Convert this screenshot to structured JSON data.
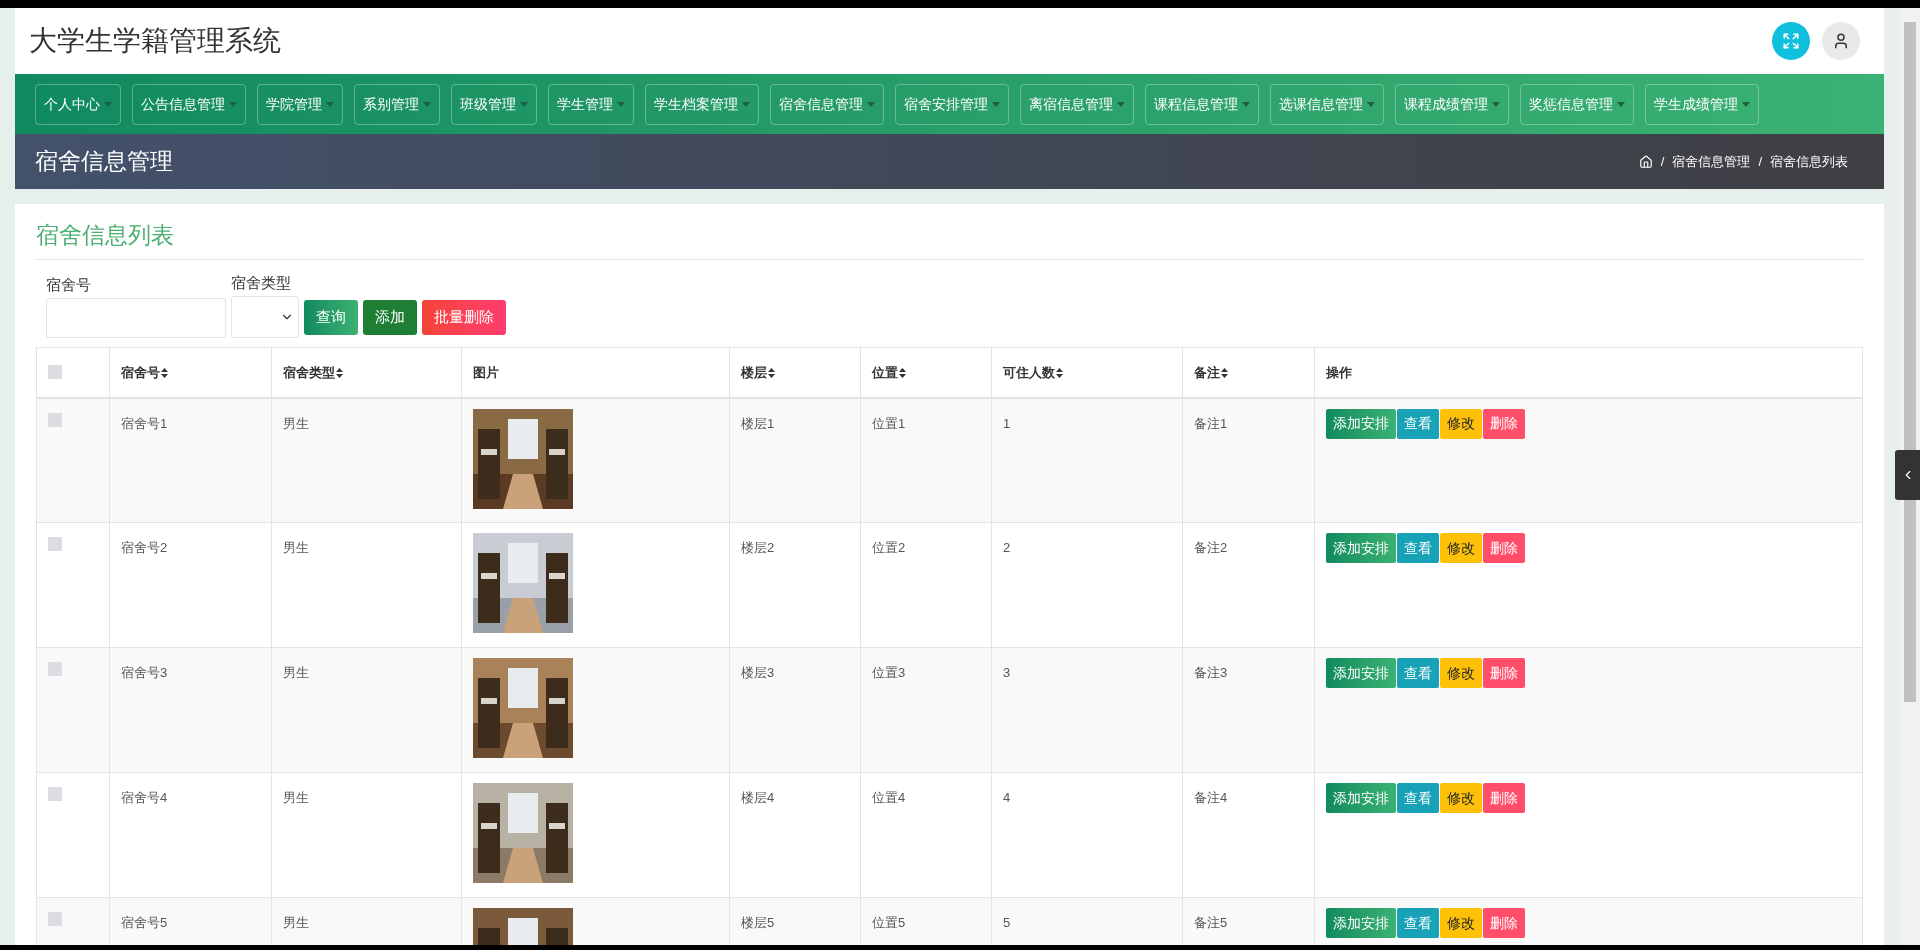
{
  "header": {
    "title": "大学生学籍管理系统"
  },
  "nav": [
    {
      "label": "个人中心"
    },
    {
      "label": "公告信息管理"
    },
    {
      "label": "学院管理"
    },
    {
      "label": "系别管理"
    },
    {
      "label": "班级管理"
    },
    {
      "label": "学生管理"
    },
    {
      "label": "学生档案管理"
    },
    {
      "label": "宿舍信息管理"
    },
    {
      "label": "宿舍安排管理"
    },
    {
      "label": "离宿信息管理"
    },
    {
      "label": "课程信息管理"
    },
    {
      "label": "选课信息管理"
    },
    {
      "label": "课程成绩管理"
    },
    {
      "label": "奖惩信息管理"
    },
    {
      "label": "学生成绩管理"
    }
  ],
  "banner": {
    "title": "宿舍信息管理",
    "separator": "/",
    "breadcrumb": [
      "宿舍信息管理",
      "宿舍信息列表"
    ]
  },
  "card": {
    "title": "宿舍信息列表"
  },
  "filters": [
    {
      "kind": "text",
      "label": "宿舍号"
    },
    {
      "kind": "select",
      "label": "宿舍类型"
    }
  ],
  "buttons": [
    {
      "kind": "search",
      "label": "查询"
    },
    {
      "kind": "add",
      "label": "添加"
    },
    {
      "kind": "delete",
      "label": "批量删除"
    }
  ],
  "table": {
    "select_all": {
      "checked": false
    },
    "columns": [
      {
        "label": "宿舍号",
        "sortable": true
      },
      {
        "label": "宿舍类型",
        "sortable": true
      },
      {
        "label": "图片",
        "sortable": false
      },
      {
        "label": "楼层",
        "sortable": true
      },
      {
        "label": "位置",
        "sortable": true
      },
      {
        "label": "可住人数",
        "sortable": true
      },
      {
        "label": "备注",
        "sortable": true
      },
      {
        "label": "操作",
        "sortable": false
      }
    ],
    "rows": [
      {
        "checked": false,
        "number": "宿舍号1",
        "type": "男生",
        "image": {
          "kind": "picture"
        },
        "floor": "楼层1",
        "location": "位置1",
        "capacity": "1",
        "note": "备注1",
        "actions": [
          {
            "kind": "arrange",
            "label": "添加安排"
          },
          {
            "kind": "view",
            "label": "查看"
          },
          {
            "kind": "edit",
            "label": "修改"
          },
          {
            "kind": "delete",
            "label": "删除"
          }
        ]
      },
      {
        "checked": false,
        "number": "宿舍号2",
        "type": "男生",
        "image": {
          "kind": "picture"
        },
        "floor": "楼层2",
        "location": "位置2",
        "capacity": "2",
        "note": "备注2",
        "actions": [
          {
            "kind": "arrange",
            "label": "添加安排"
          },
          {
            "kind": "view",
            "label": "查看"
          },
          {
            "kind": "edit",
            "label": "修改"
          },
          {
            "kind": "delete",
            "label": "删除"
          }
        ]
      },
      {
        "checked": false,
        "number": "宿舍号3",
        "type": "男生",
        "image": {
          "kind": "picture"
        },
        "floor": "楼层3",
        "location": "位置3",
        "capacity": "3",
        "note": "备注3",
        "actions": [
          {
            "kind": "arrange",
            "label": "添加安排"
          },
          {
            "kind": "view",
            "label": "查看"
          },
          {
            "kind": "edit",
            "label": "修改"
          },
          {
            "kind": "delete",
            "label": "删除"
          }
        ]
      },
      {
        "checked": false,
        "number": "宿舍号4",
        "type": "男生",
        "image": {
          "kind": "picture"
        },
        "floor": "楼层4",
        "location": "位置4",
        "capacity": "4",
        "note": "备注4",
        "actions": [
          {
            "kind": "arrange",
            "label": "添加安排"
          },
          {
            "kind": "view",
            "label": "查看"
          },
          {
            "kind": "edit",
            "label": "修改"
          },
          {
            "kind": "delete",
            "label": "删除"
          }
        ]
      },
      {
        "checked": false,
        "number": "宿舍号5",
        "type": "男生",
        "image": {
          "kind": "picture"
        },
        "floor": "楼层5",
        "location": "位置5",
        "capacity": "5",
        "note": "备注5",
        "actions": [
          {
            "kind": "arrange",
            "label": "添加安排"
          },
          {
            "kind": "view",
            "label": "查看"
          },
          {
            "kind": "edit",
            "label": "修改"
          },
          {
            "kind": "delete",
            "label": "删除"
          }
        ]
      }
    ]
  }
}
